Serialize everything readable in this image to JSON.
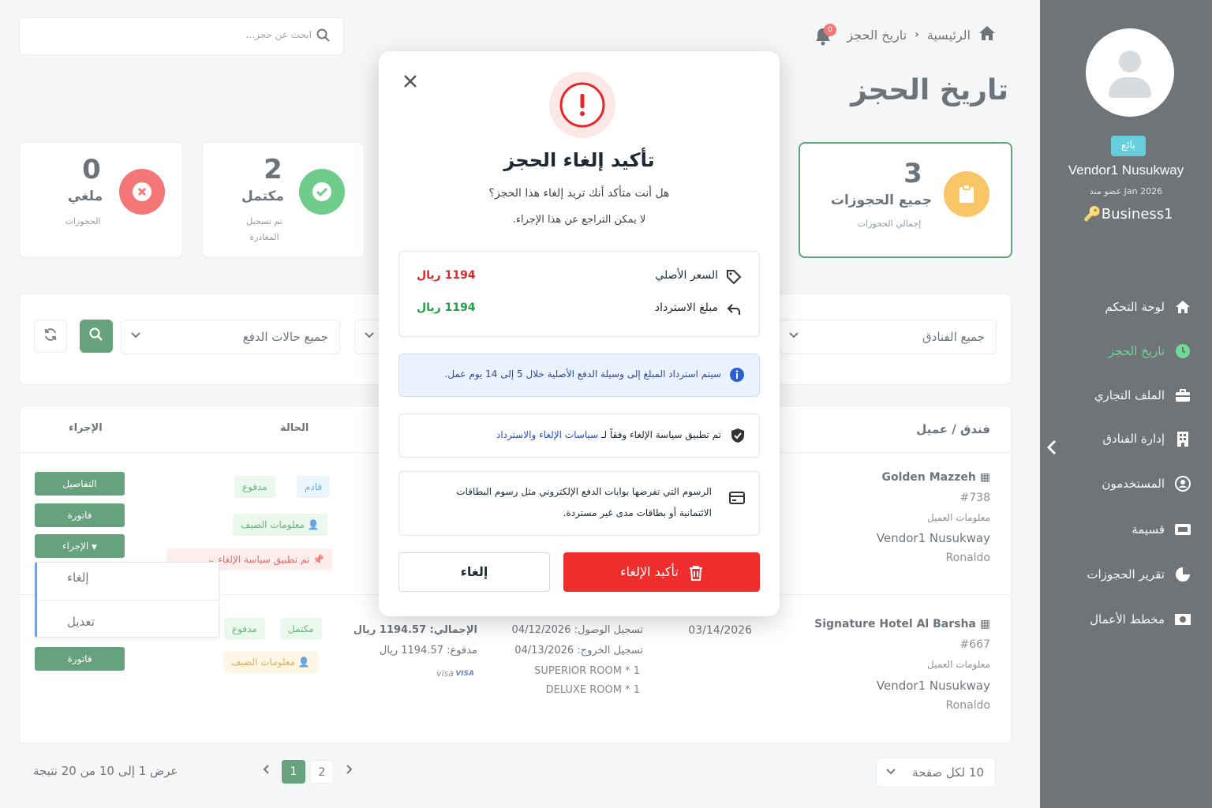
{
  "header": {
    "search_placeholder": "ابحث عن حجز...",
    "breadcrumb_home": "الرئيسية",
    "breadcrumb_current": "تاريخ الحجز",
    "notifications_count": "0",
    "page_title": "تاريخ الحجز"
  },
  "sidebar": {
    "role_badge": "بائع",
    "vendor_name": "Vendor1 Nusukway",
    "member_since": "عضو منذ Jan 2026",
    "business": "Business1",
    "items": [
      {
        "label": "لوحة التحكم",
        "icon": "home-icon"
      },
      {
        "label": "تاريخ الحجز",
        "icon": "clock-icon"
      },
      {
        "label": "الملف التجاري",
        "icon": "briefcase-icon"
      },
      {
        "label": "إدارة الفنادق",
        "icon": "building-icon"
      },
      {
        "label": "المستخدمون",
        "icon": "users-icon"
      },
      {
        "label": "قسيمة",
        "icon": "ticket-icon"
      },
      {
        "label": "تقرير الحجوزات",
        "icon": "pie-chart-icon"
      },
      {
        "label": "مخطط الأعمال",
        "icon": "money-icon"
      }
    ]
  },
  "stats": {
    "total": {
      "value": "3",
      "label": "جميع الحجوزات",
      "sub": "إجمالي الحجوزات"
    },
    "completed": {
      "value": "2",
      "label": "مكتمل",
      "sub1": "تم تسجيل",
      "sub2": "المغادرة"
    },
    "cancelled": {
      "value": "0",
      "label": "ملغي",
      "sub": "الحجوزات"
    }
  },
  "filters": {
    "hotels": "جميع الفنادق",
    "payment_status": "جميع حالات الدفع"
  },
  "table": {
    "headers": {
      "hotel_client": "فندق / عميل",
      "status": "الحالة",
      "action": "الإجراء"
    },
    "rows": [
      {
        "hotel": "Golden Mazzeh",
        "id": "#738",
        "client_info": "معلومات العميل",
        "vendor": "Vendor1 Nusukway",
        "guest": "Ronaldo",
        "status_arrival": "قادم",
        "status_payment": "مدفوع",
        "guest_info": "معلومات الضيف",
        "policy": "تم تطبيق سياسة الإلغاء"
      },
      {
        "hotel": "Signature Hotel Al Barsha",
        "id": "#667",
        "client_info": "معلومات العميل",
        "vendor": "Vendor1 Nusukway",
        "guest": "Ronaldo",
        "booking_date": "03/14/2026",
        "checkin": "تسجيل الوصول: 04/12/2026",
        "checkout": "تسجيل الخروج: 04/13/2026",
        "room1": "SUPERIOR ROOM * 1",
        "room2": "DELUXE ROOM * 1",
        "total": "الإجمالي: 1194.57 ريال",
        "paid": "مدفوع: 1194.57 ريال",
        "card1": "visa",
        "card2": "VISA",
        "status_completed": "مكتمل",
        "status_payment": "مدفوع",
        "guest_info": "معلومات الضيف"
      }
    ],
    "buttons": {
      "details": "التفاصيل",
      "invoice": "فاتورة",
      "actions": "الإجراء"
    },
    "dropdown": {
      "cancel": "إلغاء",
      "edit": "تعديل"
    }
  },
  "pagination": {
    "summary": "عرض 1 إلى 10 من 20 نتيجة",
    "pages": [
      "1",
      "2"
    ],
    "per_page": "10 لكل صفحة"
  },
  "modal": {
    "title": "تأكيد إلغاء الحجز",
    "question": "هل أنت متأكد أنك تريد إلغاء هذا الحجز؟",
    "warning": "لا يمكن التراجع عن هذا الإجراء.",
    "original_price_label": "السعر الأصلي",
    "original_price_value": "1194 ريال",
    "refund_label": "مبلغ الاسترداد",
    "refund_value": "1194 ريال",
    "refund_note": "سيتم استرداد المبلغ إلى وسيلة الدفع الأصلية خلال 5 إلى 14 يوم عمل.",
    "policy_text": "تم تطبيق سياسة الإلغاء وفقاً لـ",
    "policy_link": "سياسات الإلغاء والاسترداد",
    "fees_line1": "الرسوم التي تفرضها بوابات الدفع الإلكتروني مثل رسوم البطاقات",
    "fees_line2": "الائتمانية أو بطاقات مدى غير مستردة.",
    "cancel_button": "إلغاء",
    "confirm_button": "تأكيد الإلغاء"
  },
  "colors": {
    "primary_green": "#14703a",
    "sidebar_bg": "#222a31",
    "danger_red": "#ef2d2d",
    "success_green": "#22b14c",
    "warning_orange": "#f4a815"
  }
}
